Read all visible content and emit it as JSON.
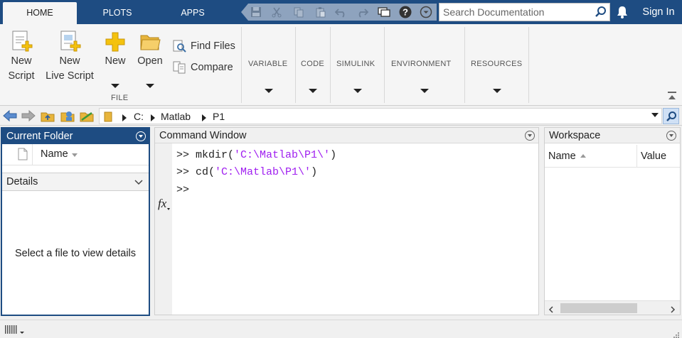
{
  "tabs": [
    {
      "label": "HOME",
      "active": true
    },
    {
      "label": "PLOTS",
      "active": false
    },
    {
      "label": "APPS",
      "active": false
    }
  ],
  "quick_access_icons": [
    "save-icon",
    "cut-icon",
    "copy-icon",
    "paste-icon",
    "undo-icon",
    "redo-icon",
    "switch-windows-icon",
    "help-icon",
    "dropdown-icon"
  ],
  "search": {
    "placeholder": "Search Documentation"
  },
  "signin_label": "Sign In",
  "ribbon": {
    "file_group": {
      "label": "FILE",
      "new_script": [
        "New",
        "Script"
      ],
      "new_live_script": [
        "New",
        "Live Script"
      ],
      "new": "New",
      "open": "Open",
      "find_files": "Find Files",
      "compare": "Compare"
    },
    "groups": [
      "VARIABLE",
      "CODE",
      "SIMULINK",
      "ENVIRONMENT",
      "RESOURCES"
    ]
  },
  "address": {
    "path": [
      "C:",
      "Matlab",
      "P1"
    ]
  },
  "current_folder": {
    "title": "Current Folder",
    "name_col": "Name",
    "details_label": "Details",
    "details_msg": "Select a file to view details"
  },
  "command_window": {
    "title": "Command Window",
    "lines": [
      {
        "prompt": ">> ",
        "cmd": "mkdir(",
        "arg": "'C:\\Matlab\\P1\\'",
        "end": ")"
      },
      {
        "prompt": ">> ",
        "cmd": "cd(",
        "arg": "'C:\\Matlab\\P1\\'",
        "end": ")"
      }
    ],
    "current_prompt": ">>",
    "fx_label": "fx"
  },
  "workspace": {
    "title": "Workspace",
    "name_col": "Name",
    "value_col": "Value"
  },
  "colors": {
    "tab_bar": "#1e4c82",
    "string": "#a020f0",
    "folder_active_border": "#1e4c82"
  }
}
